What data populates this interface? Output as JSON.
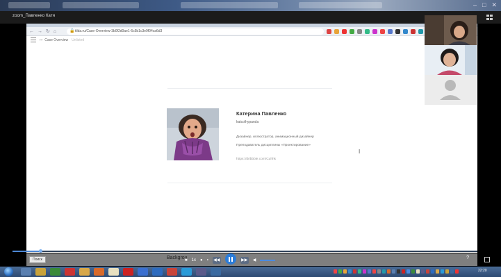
{
  "zoom_window": {
    "title": "zoom_Павленко Катя"
  },
  "browser": {
    "url": "tilda.ru/Case-Overview-3b0f2d0ae1-6c5b1c3e9f04ca6d3",
    "lock_glyph": "🔒"
  },
  "page_toolbar": {
    "breadcrumb_separator": "↦",
    "breadcrumb": "Case Overview",
    "state": "Unlisted"
  },
  "profile": {
    "name": "Катерина Павленко",
    "handle": "katcolhypanda",
    "role": "Дизайнер, иллюстратор, анимационный дизайнер",
    "teaching": "Преподаватель дисциплины «Проектирование»",
    "link": "https://dribbble.com/Cuhhk"
  },
  "player": {
    "search_label": "Поиск",
    "background_label": "Backgrou",
    "speed_label": "1x",
    "help_label": "?",
    "progress_fraction": 0.06
  },
  "taskbar": {
    "clock_time": "22:20"
  },
  "icons": {
    "hamburger": "menu-icon",
    "expand": "fullscreen-icon",
    "grid": "gallery-view-icon"
  },
  "colors": {
    "accent": "#2b7cd8",
    "player_bar": "#7f7f7f",
    "zoom_bar": "#1b1b1b"
  }
}
